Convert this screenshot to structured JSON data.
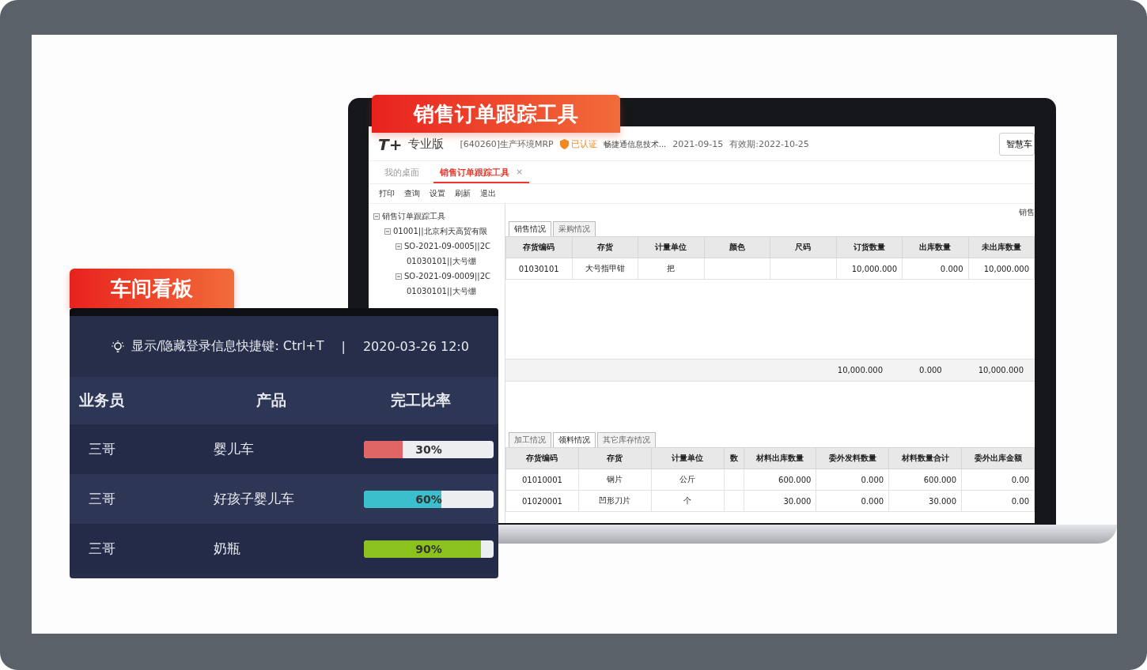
{
  "app_window": {
    "banner": "销售订单跟踪工具",
    "header": {
      "logo": "T+",
      "edition": "专业版",
      "account": "[640260]生产环境MRP",
      "verified": "已认证",
      "company": "畅捷通信息技术...",
      "date": "2021-09-15",
      "validity": "有效期:2022-10-25",
      "button": "智慧车"
    },
    "tabs": [
      {
        "label": "我的桌面",
        "selected": false,
        "closable": false
      },
      {
        "label": "销售订单跟踪工具",
        "selected": true,
        "closable": true
      }
    ],
    "close_tab": "×",
    "toolbar": [
      "打印",
      "查询",
      "设置",
      "刷新",
      "退出"
    ],
    "tree": [
      {
        "label": "销售订单跟踪工具",
        "children": [
          {
            "label": "01001||北京利天高贸有限",
            "children": [
              {
                "label": "SO-2021-09-0005||2C",
                "children": [
                  {
                    "label": "01030101||大号绷"
                  }
                ]
              },
              {
                "label": "SO-2021-09-0009||2C",
                "children": [
                  {
                    "label": "01030101||大号绷"
                  }
                ]
              }
            ]
          }
        ]
      }
    ],
    "right_label": "销售",
    "upper_tabs": [
      {
        "label": "销售情况",
        "selected": true
      },
      {
        "label": "采购情况",
        "selected": false
      }
    ],
    "upper_table": {
      "columns": [
        "存货编码",
        "存货",
        "计量单位",
        "颜色",
        "尺码",
        "订货数量",
        "出库数量",
        "未出库数量"
      ],
      "rows": [
        [
          "01030101",
          "大号指甲钳",
          "把",
          "",
          "",
          "10,000.000",
          "0.000",
          "10,000.000"
        ]
      ],
      "totals": [
        "10,000.000",
        "0.000",
        "10,000.000"
      ]
    },
    "lower_tabs": [
      {
        "label": "加工情况",
        "selected": false
      },
      {
        "label": "领料情况",
        "selected": true
      },
      {
        "label": "其它库存情况",
        "selected": false
      }
    ],
    "lower_table": {
      "columns": [
        "存货编码",
        "存货",
        "计量单位",
        "数",
        "材料出库数量",
        "委外发料数量",
        "材料数量合计",
        "委外出库金额"
      ],
      "rows": [
        [
          "01010001",
          "钢片",
          "公斤",
          "",
          "600.000",
          "0.000",
          "600.000",
          "0.00"
        ],
        [
          "01020001",
          "凹形刀片",
          "个",
          "",
          "30.000",
          "0.000",
          "30.000",
          "0.00"
        ]
      ]
    }
  },
  "kanban": {
    "banner": "车间看板",
    "hint": "显示/隐藏登录信息快捷键: Ctrl+T",
    "separator": "|",
    "datetime": "2020-03-26 12:0",
    "columns": [
      "业务员",
      "产品",
      "完工比率"
    ],
    "rows": [
      {
        "person": "三哥",
        "product": "婴儿车",
        "level": 0.3,
        "reading": "30%",
        "color": "#e06666"
      },
      {
        "person": "三哥",
        "product": "好孩子婴儿车",
        "level": 0.6,
        "reading": "60%",
        "color": "#3bbfcc"
      },
      {
        "person": "三哥",
        "product": "奶瓶",
        "level": 0.9,
        "reading": "90%",
        "color": "#8cc21e"
      }
    ]
  }
}
